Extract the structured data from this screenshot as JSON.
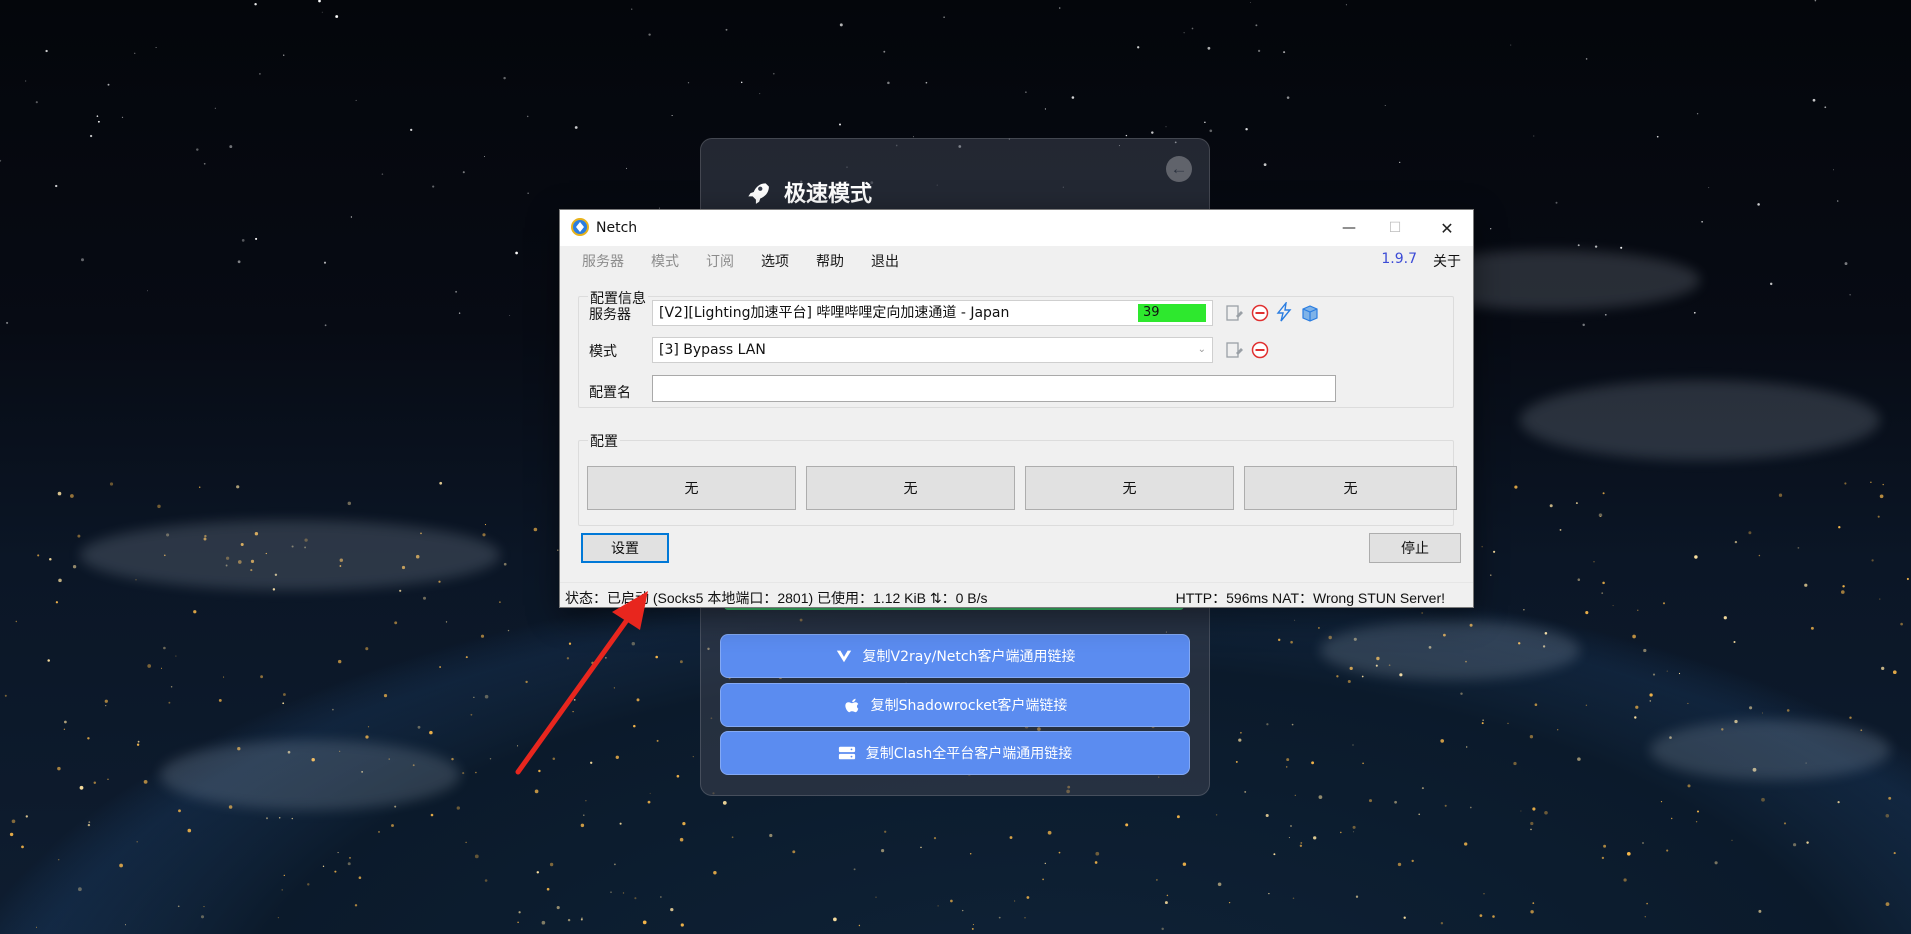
{
  "website": {
    "title": "极速模式",
    "back_icon": "arrow-left-icon",
    "buttons": [
      {
        "label": "复制V2ray/Netch客户端通用链接",
        "icon": "v2ray-icon"
      },
      {
        "label": "复制Shadowrocket客户端链接",
        "icon": "apple-icon"
      },
      {
        "label": "复制Clash全平台客户端通用链接",
        "icon": "server-icon"
      }
    ],
    "accent": "#5b8cf0"
  },
  "window": {
    "title": "Netch",
    "controls": {
      "minimize": "—",
      "maximize": "☐",
      "close": "✕"
    }
  },
  "menu": {
    "items": [
      "服务器",
      "模式",
      "订阅",
      "选项",
      "帮助",
      "退出"
    ],
    "version": "1.9.7",
    "about": "关于"
  },
  "config_info": {
    "group_label": "配置信息",
    "server_label": "服务器",
    "server_value": "[V2][Lighting加速平台] 哔哩哔哩定向加速通道 - Japan",
    "server_ping": "39",
    "mode_label": "模式",
    "mode_value": "[3] Bypass LAN",
    "profile_name_label": "配置名",
    "profile_name_value": ""
  },
  "profiles": {
    "group_label": "配置",
    "buttons": [
      "无",
      "无",
      "无",
      "无"
    ]
  },
  "actions": {
    "settings": "设置",
    "stop": "停止"
  },
  "status": {
    "left": "状态：已启动 (Socks5 本地端口：2801)  已使用：1.12 KiB  ⇅：0 B/s",
    "right": "HTTP：596ms  NAT：Wrong STUN Server!"
  },
  "colors": {
    "ping_badge": "#2ee82e",
    "version": "#3c4bd6",
    "focus": "#0078d7",
    "arrow": "#e8261e"
  }
}
